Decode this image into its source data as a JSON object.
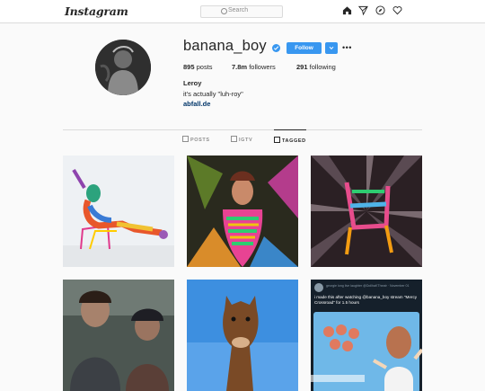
{
  "nav": {
    "logo": "Instagram",
    "search_placeholder": "Search",
    "icons": [
      "home-icon",
      "direct-icon",
      "explore-icon",
      "activity-heart-icon"
    ]
  },
  "profile": {
    "username": "banana_boy",
    "verified": true,
    "follow_label": "Follow",
    "posts_count": "895",
    "posts_label": "posts",
    "followers_count": "7.8m",
    "followers_label": "followers",
    "following_count": "291",
    "following_label": "following",
    "full_name": "Leroy",
    "bio": "it's actually \"luh-roy\"",
    "link": "abfall.de"
  },
  "tabs": [
    {
      "label": "POSTS",
      "icon": "grid-icon",
      "active": false
    },
    {
      "label": "IGTV",
      "icon": "igtv-icon",
      "active": false
    },
    {
      "label": "TAGGED",
      "icon": "tag-icon",
      "active": true
    }
  ],
  "grid_posts": [
    {
      "name": "post-colorful-figure-on-chair"
    },
    {
      "name": "post-woman-in-rainbow-outfit"
    },
    {
      "name": "post-rainbow-chair-dark"
    },
    {
      "name": "post-two-people-car"
    },
    {
      "name": "post-horse-blue-sky"
    },
    {
      "name": "post-tweet-screenshot",
      "tweet_author": "georgie long live laughter",
      "tweet_handle": "@DollhaKTheatr · November 01",
      "tweet_text": "i made this after watching @banana_boy stream \"Mercy Crossroad\" for 1.5 hours"
    }
  ],
  "colors": {
    "accent": "#3897f0",
    "link": "#003569",
    "border": "#dbdbdb",
    "text": "#262626",
    "muted": "#8e8e8e"
  }
}
